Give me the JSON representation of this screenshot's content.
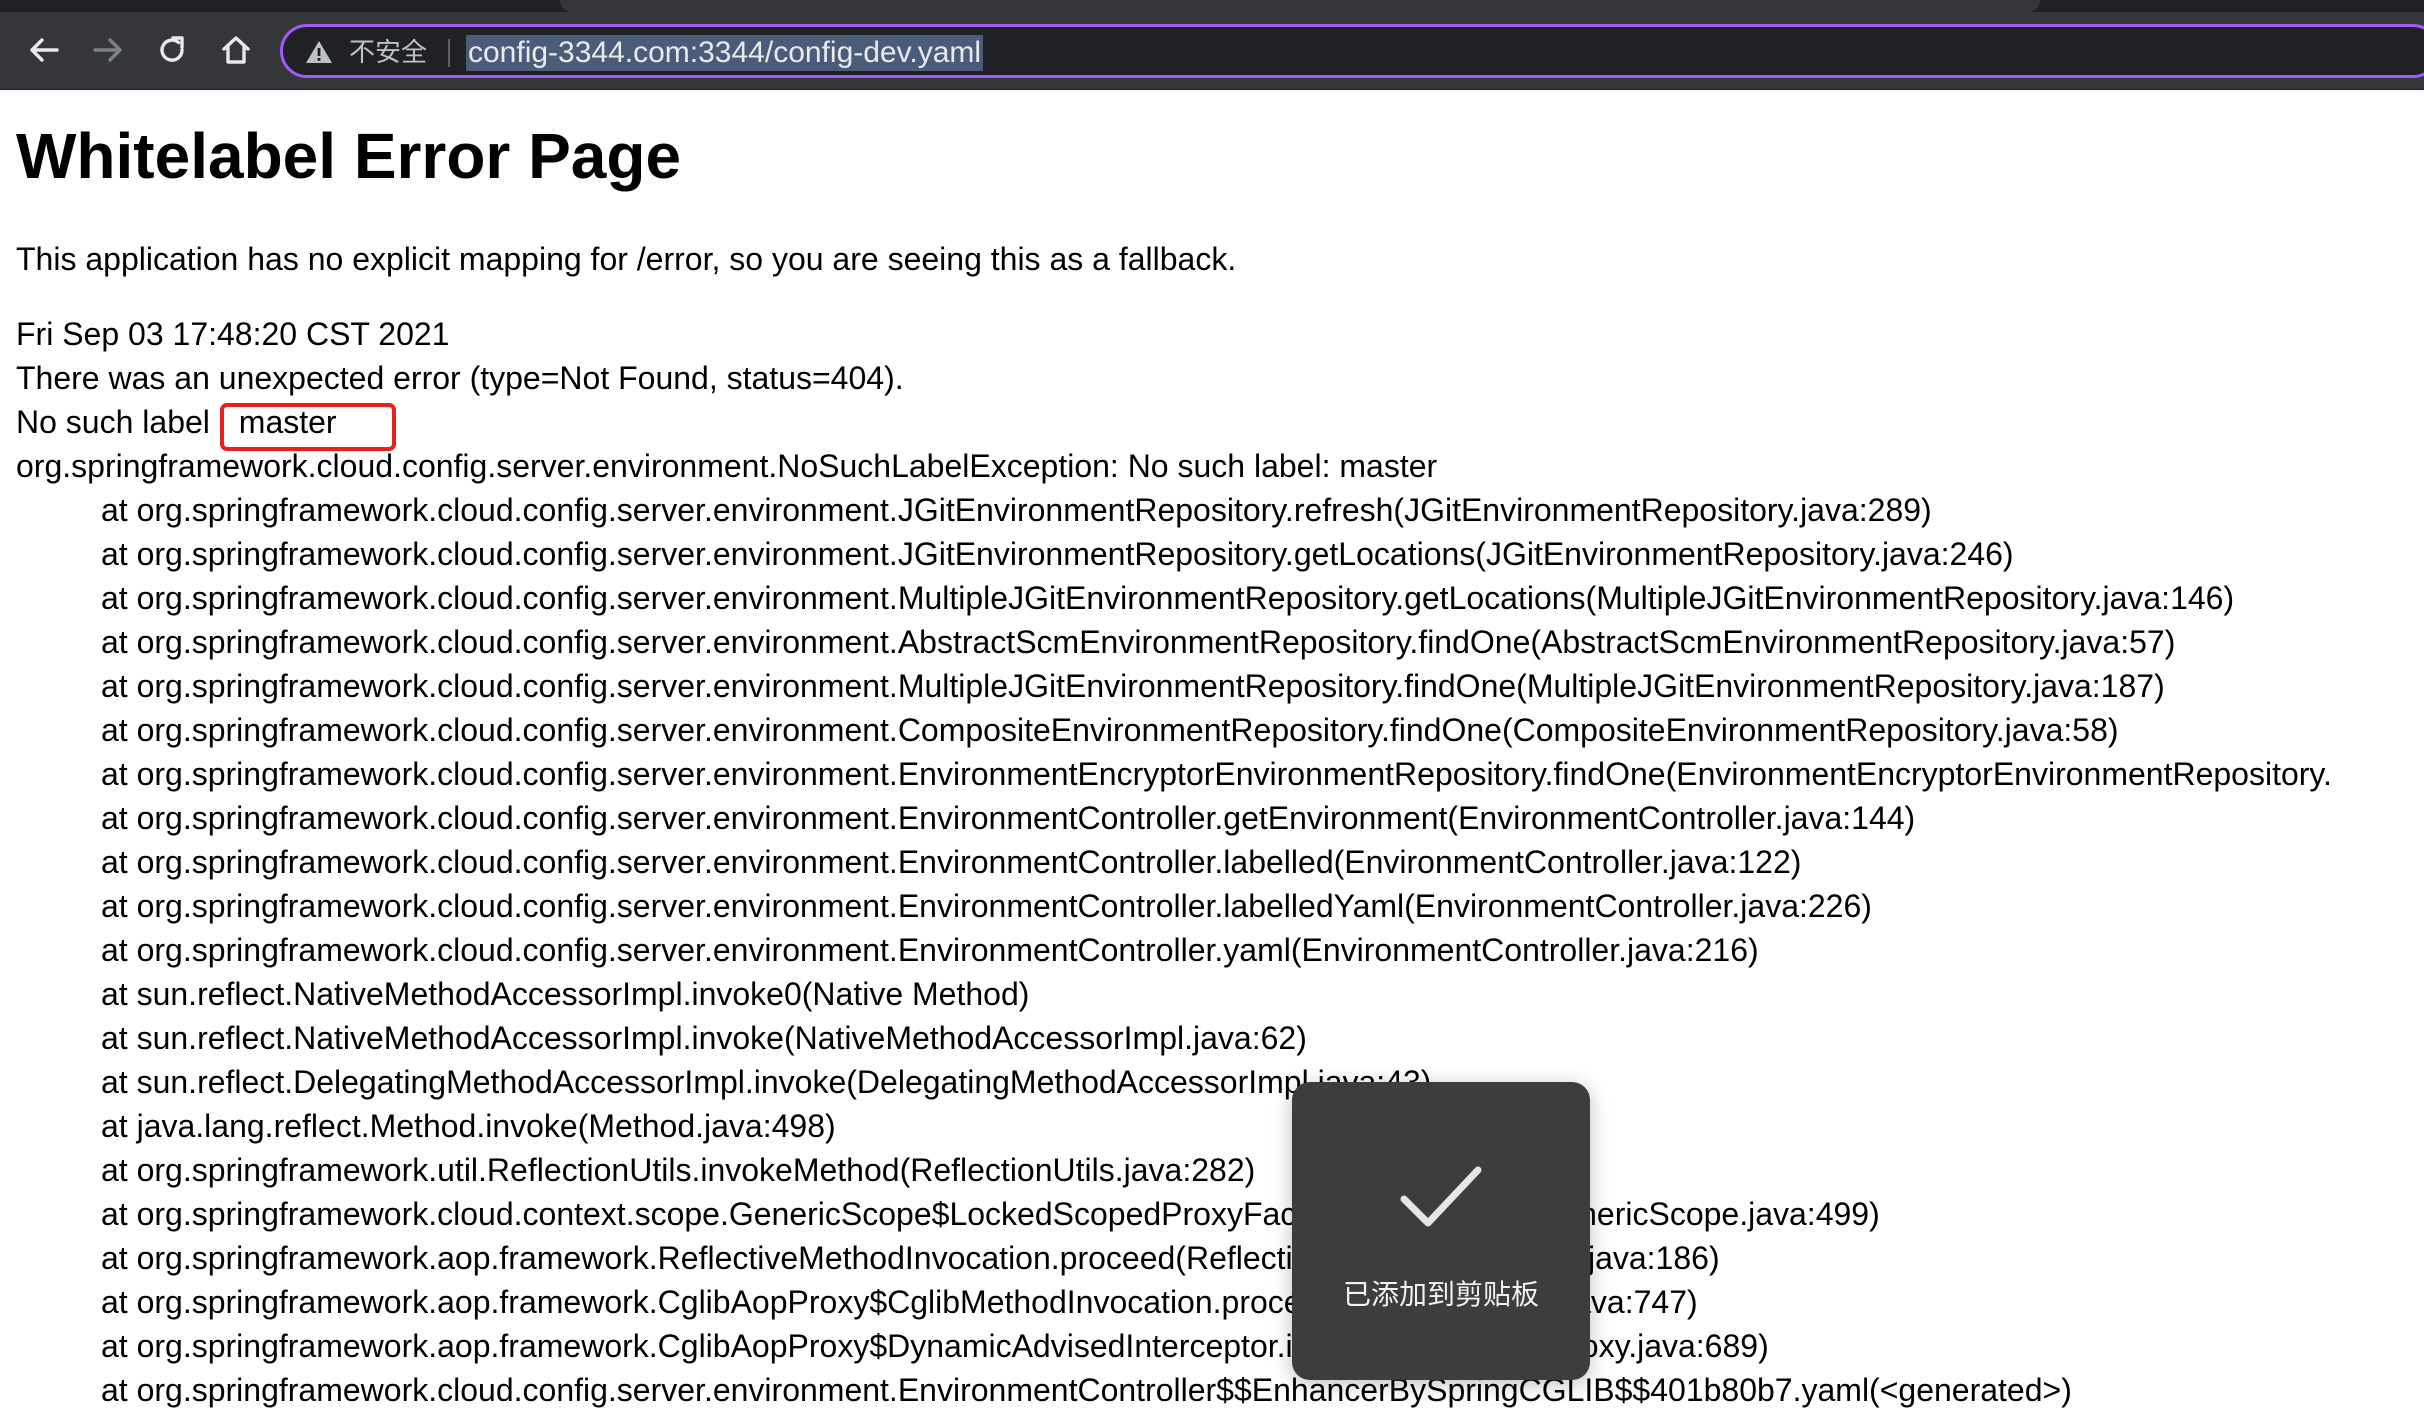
{
  "browser": {
    "insecure_label": "不安全",
    "url": "config-3344.com:3344/config-dev.yaml",
    "colors": {
      "toolbar": "#35363a",
      "omnibox_border": "#a05bf5",
      "url_selection": "#4b5c7b"
    },
    "icons": [
      "back-arrow-icon",
      "forward-arrow-icon",
      "reload-icon",
      "home-icon",
      "warning-triangle-icon"
    ]
  },
  "page": {
    "title": "Whitelabel Error Page",
    "description": "This application has no explicit mapping for /error, so you are seeing this as a fallback.",
    "timestamp": "Fri Sep 03 17:48:20 CST 2021",
    "error_line": "There was an unexpected error (type=Not Found, status=404).",
    "label_prefix": "No such label",
    "label_value": "master",
    "highlight_color": "#e8211d",
    "exception": "org.springframework.cloud.config.server.environment.NoSuchLabelException: No such label: master",
    "stack_trace": [
      "at org.springframework.cloud.config.server.environment.JGitEnvironmentRepository.refresh(JGitEnvironmentRepository.java:289)",
      "at org.springframework.cloud.config.server.environment.JGitEnvironmentRepository.getLocations(JGitEnvironmentRepository.java:246)",
      "at org.springframework.cloud.config.server.environment.MultipleJGitEnvironmentRepository.getLocations(MultipleJGitEnvironmentRepository.java:146)",
      "at org.springframework.cloud.config.server.environment.AbstractScmEnvironmentRepository.findOne(AbstractScmEnvironmentRepository.java:57)",
      "at org.springframework.cloud.config.server.environment.MultipleJGitEnvironmentRepository.findOne(MultipleJGitEnvironmentRepository.java:187)",
      "at org.springframework.cloud.config.server.environment.CompositeEnvironmentRepository.findOne(CompositeEnvironmentRepository.java:58)",
      "at org.springframework.cloud.config.server.environment.EnvironmentEncryptorEnvironmentRepository.findOne(EnvironmentEncryptorEnvironmentRepository.",
      "at org.springframework.cloud.config.server.environment.EnvironmentController.getEnvironment(EnvironmentController.java:144)",
      "at org.springframework.cloud.config.server.environment.EnvironmentController.labelled(EnvironmentController.java:122)",
      "at org.springframework.cloud.config.server.environment.EnvironmentController.labelledYaml(EnvironmentController.java:226)",
      "at org.springframework.cloud.config.server.environment.EnvironmentController.yaml(EnvironmentController.java:216)",
      "at sun.reflect.NativeMethodAccessorImpl.invoke0(Native Method)",
      "at sun.reflect.NativeMethodAccessorImpl.invoke(NativeMethodAccessorImpl.java:62)",
      "at sun.reflect.DelegatingMethodAccessorImpl.invoke(DelegatingMethodAccessorImpl.java:43)",
      "at java.lang.reflect.Method.invoke(Method.java:498)",
      "at org.springframework.util.ReflectionUtils.invokeMethod(ReflectionUtils.java:282)",
      "at org.springframework.cloud.context.scope.GenericScope$LockedScopedProxyFactoryBean.invoke(GenericScope.java:499)",
      "at org.springframework.aop.framework.ReflectiveMethodInvocation.proceed(ReflectiveMethodInvocation.java:186)",
      "at org.springframework.aop.framework.CglibAopProxy$CglibMethodInvocation.proceed(CglibAopProxy.java:747)",
      "at org.springframework.aop.framework.CglibAopProxy$DynamicAdvisedInterceptor.intercept(CglibAopProxy.java:689)",
      "at org.springframework.cloud.config.server.environment.EnvironmentController$$EnhancerBySpringCGLIB$$401b80b7.yaml(<generated>)"
    ]
  },
  "toast": {
    "message": "已添加到剪贴板",
    "icon": "checkmark-icon"
  }
}
